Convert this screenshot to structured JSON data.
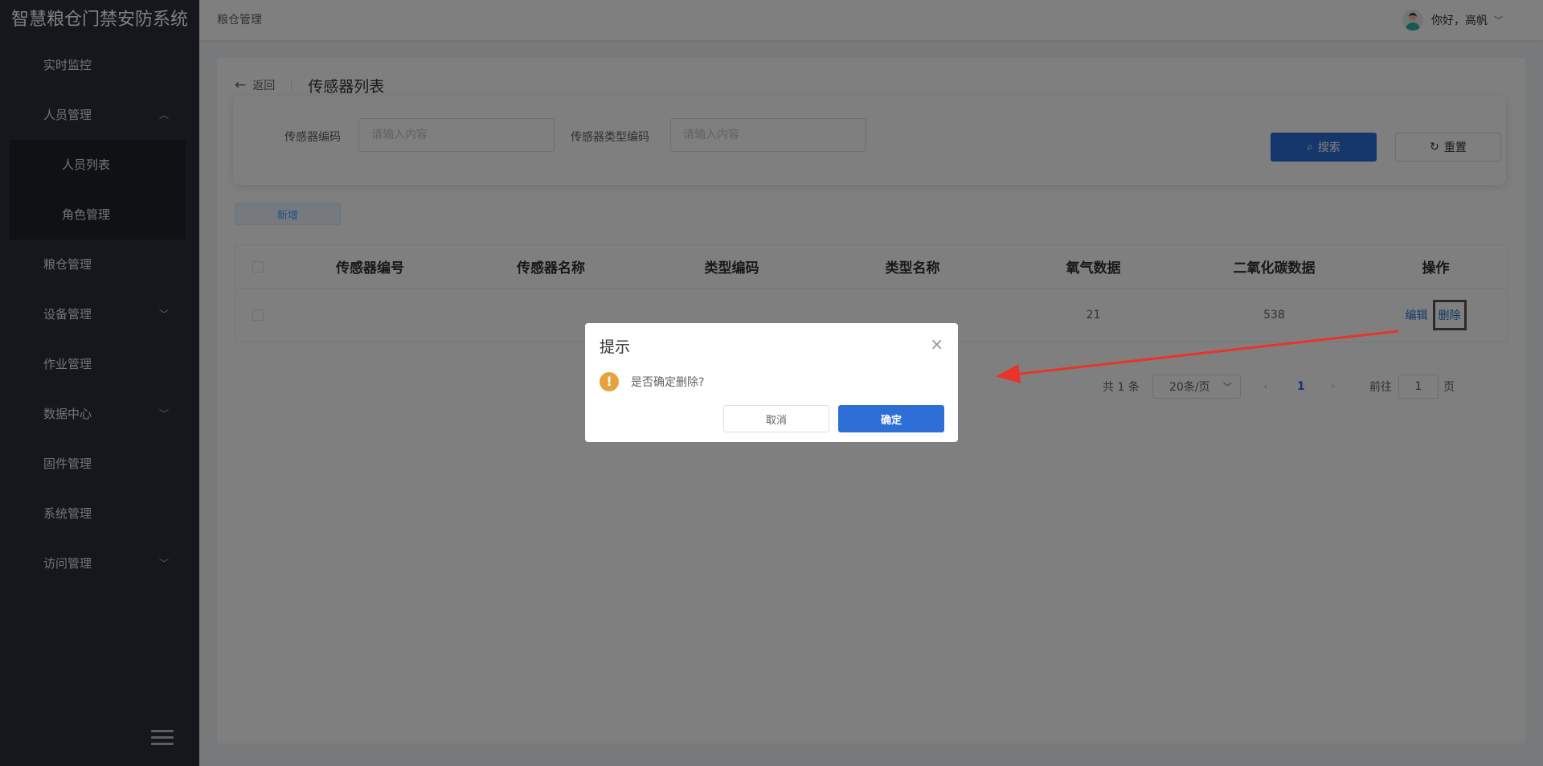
{
  "app": {
    "title": "智慧粮仓门禁安防系统"
  },
  "sidebar": {
    "items": [
      {
        "label": "实时监控"
      },
      {
        "label": "人员管理",
        "expanded": true,
        "children": [
          {
            "label": "人员列表"
          },
          {
            "label": "角色管理"
          }
        ]
      },
      {
        "label": "粮仓管理"
      },
      {
        "label": "设备管理"
      },
      {
        "label": "作业管理"
      },
      {
        "label": "数据中心"
      },
      {
        "label": "固件管理"
      },
      {
        "label": "系统管理"
      },
      {
        "label": "访问管理"
      }
    ]
  },
  "topbar": {
    "breadcrumb": "粮仓管理",
    "greeting": "你好，高帆"
  },
  "page": {
    "back_label": "返回",
    "title": "传感器列表"
  },
  "search": {
    "fields": [
      {
        "label": "传感器编码",
        "placeholder": "请输入内容",
        "value": ""
      },
      {
        "label": "传感器类型编码",
        "placeholder": "请输入内容",
        "value": ""
      }
    ],
    "search_label": "搜索",
    "reset_label": "重置"
  },
  "toolbar": {
    "add_label": "新增"
  },
  "table": {
    "columns": [
      "传感器编号",
      "传感器名称",
      "类型编码",
      "类型名称",
      "氧气数据",
      "二氧化碳数据",
      "操作"
    ],
    "rows": [
      {
        "sensor_no": "",
        "sensor_name": "",
        "type_code": "",
        "type_name": "",
        "oxygen": "21",
        "co2": "538",
        "actions": [
          "编辑",
          "删除"
        ]
      }
    ]
  },
  "pagination": {
    "total_text": "共 1 条",
    "page_size": "20条/页",
    "current_page": "1",
    "goto_label": "前往",
    "goto_value": "1",
    "page_suffix": "页"
  },
  "dialog": {
    "title": "提示",
    "message": "是否确定删除?",
    "cancel_label": "取消",
    "confirm_label": "确定"
  },
  "colors": {
    "primary": "#2d6fd6",
    "sidebar_bg": "#2b2f3a",
    "warning": "#e6a23c",
    "annotation_arrow": "#e8342a"
  },
  "icons": {
    "back": "arrow-left-icon",
    "search": "search-icon",
    "reset": "refresh-icon",
    "close": "close-icon",
    "warning": "warning-icon",
    "collapse": "menu-fold-icon"
  }
}
